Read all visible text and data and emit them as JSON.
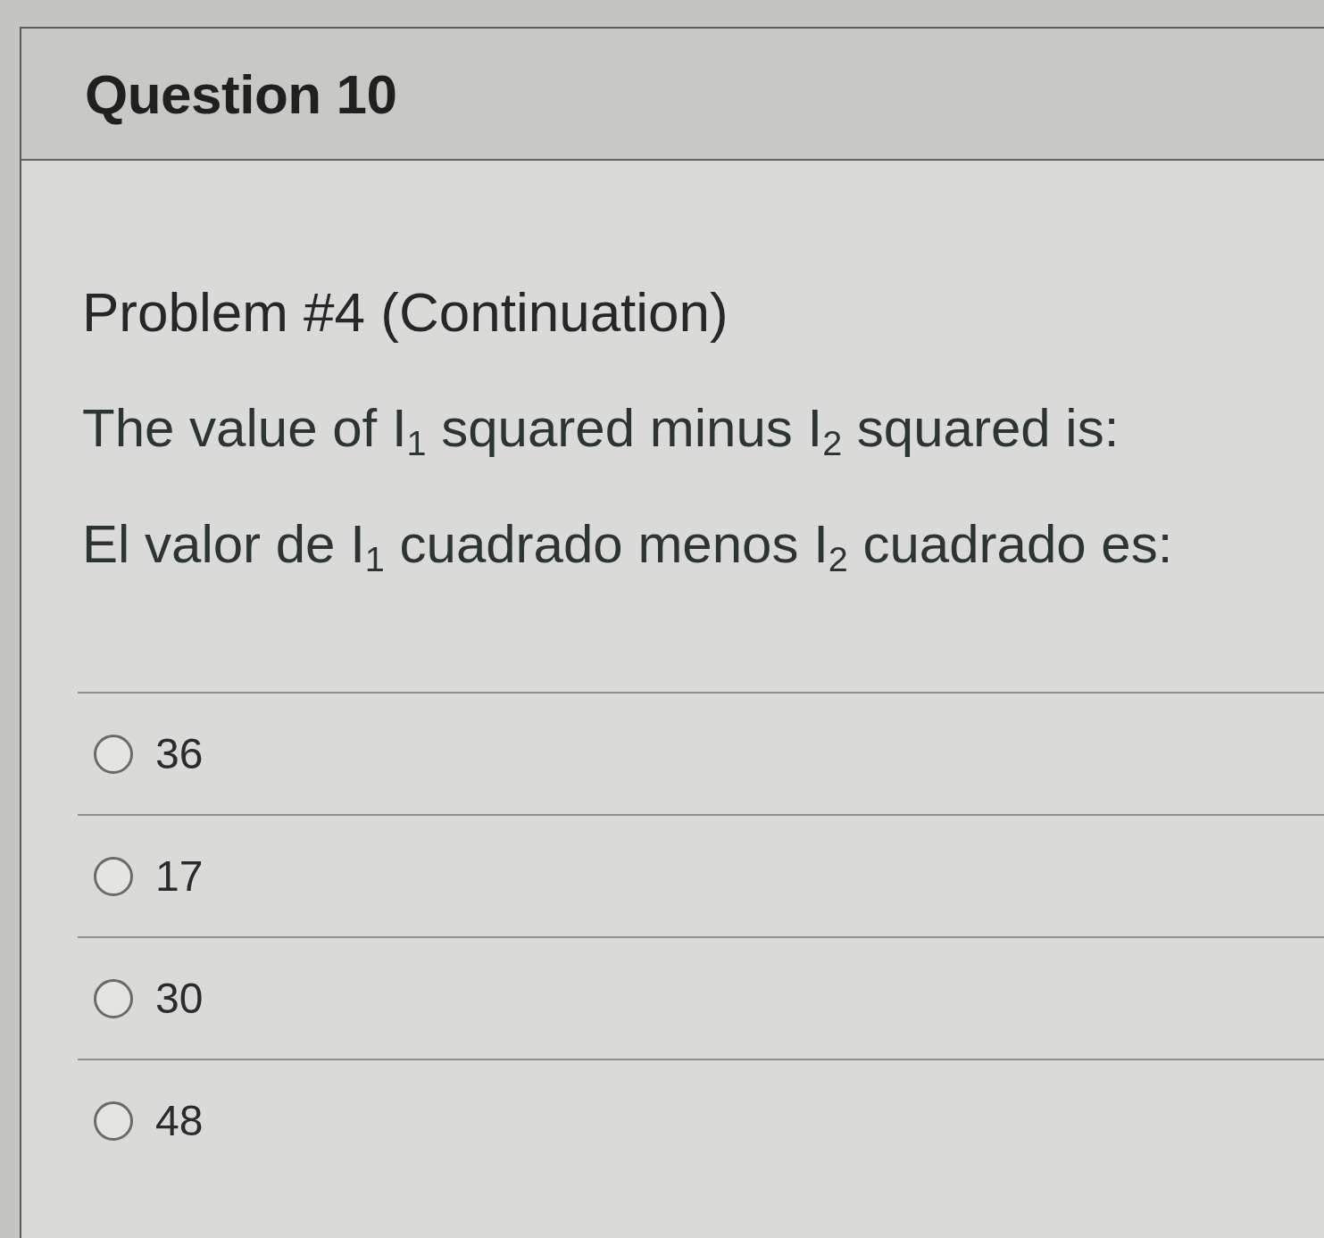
{
  "question": {
    "title": "Question 10"
  },
  "body": {
    "heading": "Problem #4 (Continuation)",
    "prompts": [
      "The value of I$_{1}$ squared minus I$_{2}$ squared is:",
      "El valor de I$_{1}$ cuadrado menos I$_{2}$ cuadrado es:"
    ]
  },
  "answers": [
    {
      "label": "36",
      "selected": false
    },
    {
      "label": "17",
      "selected": false
    },
    {
      "label": "30",
      "selected": false
    },
    {
      "label": "48",
      "selected": false
    }
  ]
}
